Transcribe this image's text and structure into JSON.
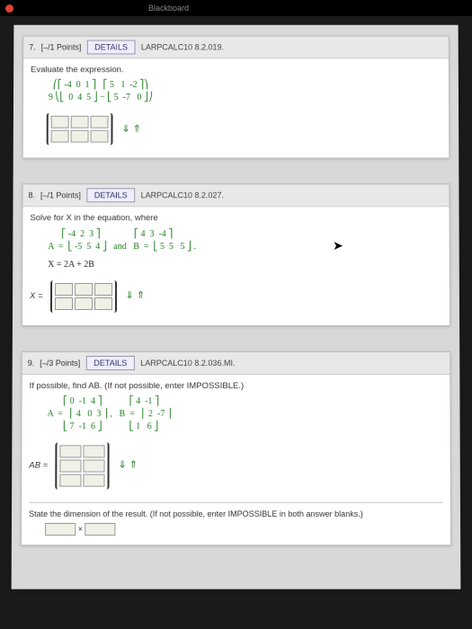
{
  "topbar": {
    "title": "Blackboard"
  },
  "q7": {
    "num": "7.",
    "points": "[–/1 Points]",
    "details": "DETAILS",
    "code": "LARPCALC10 8.2.019.",
    "prompt": "Evaluate the expression.",
    "expr_line1": "  ⎛⎡ -4  0  1 ⎤   ⎡ 5   1  -2 ⎤⎞",
    "expr_line2": "9 ⎝⎣  0  4  5 ⎦ − ⎣ 5  -7   0 ⎦⎠",
    "arrows": "⇓ ⇑"
  },
  "q8": {
    "num": "8.",
    "points": "[–/1 Points]",
    "details": "DETAILS",
    "code": "LARPCALC10 8.2.027.",
    "prompt": "Solve for X in the equation, where",
    "expr_line1": "      ⎡ -4  2  3 ⎤               ⎡ 4  3  -4 ⎤",
    "expr_line2": "A  =  ⎣ -5  5  4 ⎦   and   B  =  ⎣ 5  5   5 ⎦ .",
    "eq": "X = 2A + 2B",
    "result_label": "X =",
    "arrows": "⇓ ⇑"
  },
  "q9": {
    "num": "9.",
    "points": "[–/3 Points]",
    "details": "DETAILS",
    "code": "LARPCALC10 8.2.036.MI.",
    "prompt": "If possible, find AB. (If not possible, enter IMPOSSIBLE.)",
    "expr_line1": "       ⎡ 0  -1  4 ⎤            ⎡ 4  -1 ⎤",
    "expr_line2": "A  =   ⎢ 4   0  3 ⎥ ,   B  =   ⎢ 2  -7 ⎥",
    "expr_line3": "       ⎣ 7  -1  6 ⎦            ⎣ 1   6 ⎦",
    "result_label": "AB =",
    "arrows": "⇓ ⇑",
    "dim_prompt": "State the dimension of the result. (If not possible, enter IMPOSSIBLE in both answer blanks.)",
    "dim_sep": "×"
  }
}
